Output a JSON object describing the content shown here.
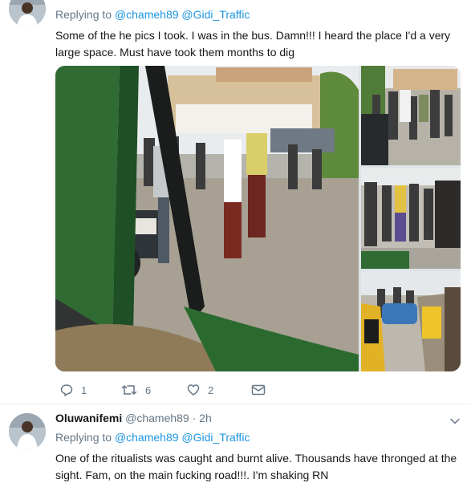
{
  "tweet1": {
    "reply_prefix": "Replying to",
    "mentions": [
      "@chameh89",
      "@Gidi_Traffic"
    ],
    "text": "Some of the he pics I took. I was in the bus. Damn!!! I heard the place I'd a very large space. Must have took them months to dig",
    "media_icons": [
      "photo-bus-window",
      "photo-crowd-street",
      "photo-crowd-people",
      "photo-yellow-bus"
    ],
    "actions": {
      "reply_icon": "reply-icon",
      "reply_count": "1",
      "retweet_icon": "retweet-icon",
      "retweet_count": "6",
      "like_icon": "heart-icon",
      "like_count": "2",
      "dm_icon": "envelope-icon"
    }
  },
  "tweet2": {
    "name": "Oluwanifemi",
    "handle": "@chameh89",
    "separator": "·",
    "time": "2h",
    "reply_prefix": "Replying to",
    "mentions": [
      "@chameh89",
      "@Gidi_Traffic"
    ],
    "text": "One of the ritualists was caught and burnt alive. Thousands have thronged at the sight. Fam, on the main fucking road!!!. I'm shaking RN",
    "menu_icon": "chevron-down-icon"
  },
  "colors": {
    "link": "#1b95e0",
    "secondary": "#657786",
    "text": "#14171a",
    "divider": "#e6ecf0"
  }
}
